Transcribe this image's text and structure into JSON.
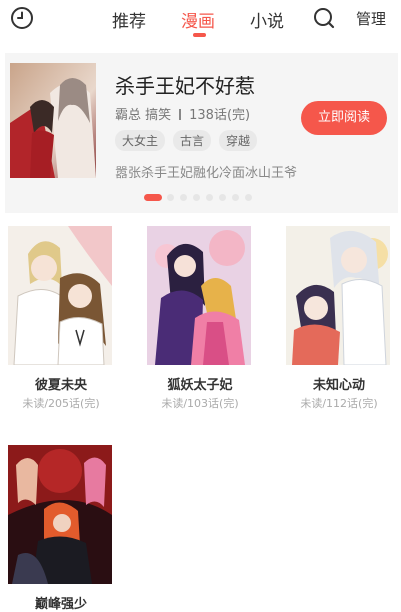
{
  "nav": {
    "tabs": [
      "推荐",
      "漫画",
      "小说"
    ],
    "active_index": 1,
    "manage_label": "管理",
    "icons": {
      "left": "clock-icon",
      "search": "search-icon"
    }
  },
  "featured": {
    "title": "杀手王妃不好惹",
    "genres": "霸总 搞笑",
    "chapters": "138话(完)",
    "tags": [
      "大女主",
      "古言",
      "穿越"
    ],
    "read_button": "立即阅读",
    "description": "嚣张杀手王妃融化冷面冰山王爷",
    "carousel": {
      "total": 8,
      "active": 0
    }
  },
  "books": [
    {
      "title": "彼夏未央",
      "progress": "未读/205话(完)"
    },
    {
      "title": "狐妖太子妃",
      "progress": "未读/103话(完)"
    },
    {
      "title": "未知心动",
      "progress": "未读/112话(完)"
    },
    {
      "title": "巅峰强少",
      "progress": ""
    }
  ],
  "colors": {
    "accent": "#f5574b",
    "banner_bg": "#f5f5f5",
    "tag_bg": "#e9e9e9"
  }
}
